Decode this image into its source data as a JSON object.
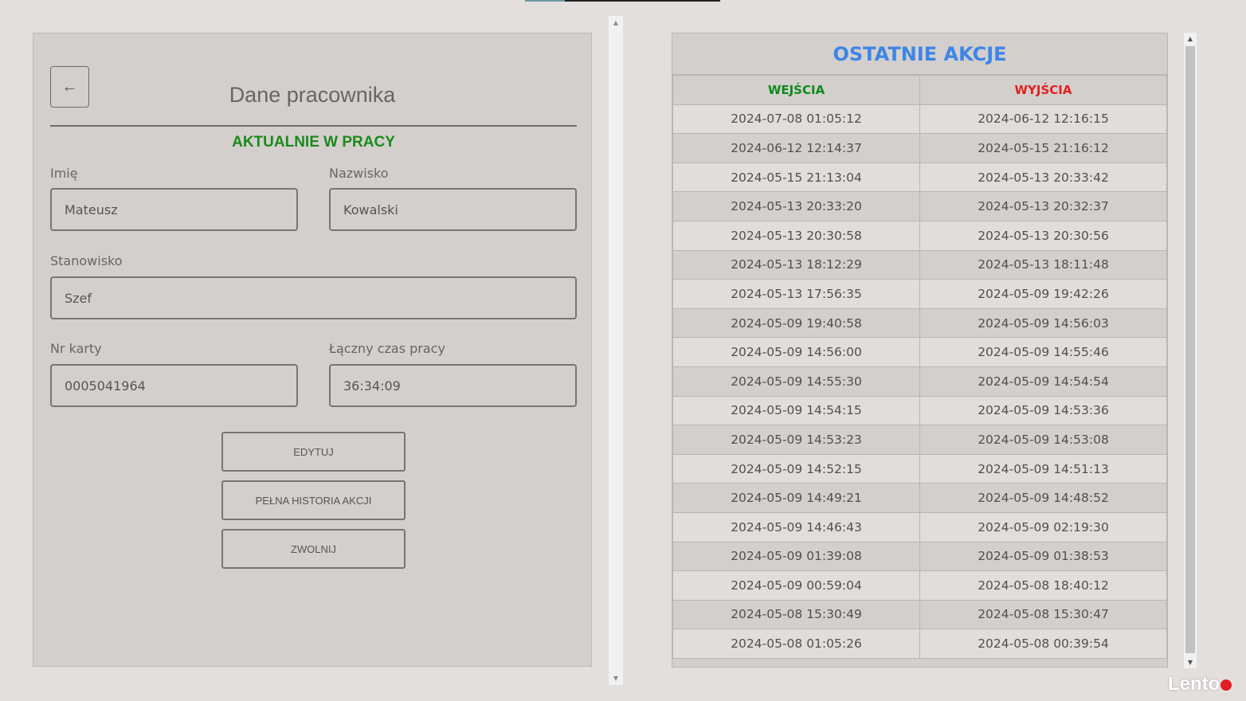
{
  "left_panel": {
    "back_glyph": "←",
    "title": "Dane pracownika",
    "status": "AKTUALNIE W PRACY",
    "fields": {
      "first_name": {
        "label": "Imię",
        "value": "Mateusz"
      },
      "last_name": {
        "label": "Nazwisko",
        "value": "Kowalski"
      },
      "position": {
        "label": "Stanowisko",
        "value": "Szef"
      },
      "card_number": {
        "label": "Nr karty",
        "value": "0005041964"
      },
      "total_time": {
        "label": "Łączny czas pracy",
        "value": "36:34:09"
      }
    },
    "buttons": {
      "edit": "EDYTUJ",
      "history": "PEŁNA HISTORIA AKCJI",
      "fire": "ZWOLNIJ"
    }
  },
  "right_panel": {
    "title": "OSTATNIE AKCJE",
    "columns": {
      "entries": "WEJŚCIA",
      "exits": "WYJŚCIA"
    },
    "rows": [
      [
        "2024-07-08 01:05:12",
        "2024-06-12 12:16:15"
      ],
      [
        "2024-06-12 12:14:37",
        "2024-05-15 21:16:12"
      ],
      [
        "2024-05-15 21:13:04",
        "2024-05-13 20:33:42"
      ],
      [
        "2024-05-13 20:33:20",
        "2024-05-13 20:32:37"
      ],
      [
        "2024-05-13 20:30:58",
        "2024-05-13 20:30:56"
      ],
      [
        "2024-05-13 18:12:29",
        "2024-05-13 18:11:48"
      ],
      [
        "2024-05-13 17:56:35",
        "2024-05-09 19:42:26"
      ],
      [
        "2024-05-09 19:40:58",
        "2024-05-09 14:56:03"
      ],
      [
        "2024-05-09 14:56:00",
        "2024-05-09 14:55:46"
      ],
      [
        "2024-05-09 14:55:30",
        "2024-05-09 14:54:54"
      ],
      [
        "2024-05-09 14:54:15",
        "2024-05-09 14:53:36"
      ],
      [
        "2024-05-09 14:53:23",
        "2024-05-09 14:53:08"
      ],
      [
        "2024-05-09 14:52:15",
        "2024-05-09 14:51:13"
      ],
      [
        "2024-05-09 14:49:21",
        "2024-05-09 14:48:52"
      ],
      [
        "2024-05-09 14:46:43",
        "2024-05-09 02:19:30"
      ],
      [
        "2024-05-09 01:39:08",
        "2024-05-09 01:38:53"
      ],
      [
        "2024-05-09 00:59:04",
        "2024-05-08 18:40:12"
      ],
      [
        "2024-05-08 15:30:49",
        "2024-05-08 15:30:47"
      ],
      [
        "2024-05-08 01:05:26",
        "2024-05-08 00:39:54"
      ]
    ]
  },
  "watermark": "Lento",
  "colors": {
    "status_green": "#1a8a1a",
    "title_blue": "#3d86e6",
    "entries_green": "#0d8a1a",
    "exits_red": "#e22020"
  }
}
